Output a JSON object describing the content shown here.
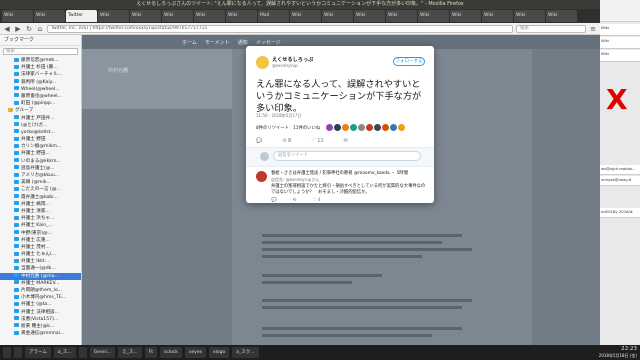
{
  "window": {
    "title": "えくせるしろっぷさんのツイート: \"えん罪になる人って、誤解されやすいというかコミュニケーションが下手な方が多い印象。\" - Mozilla Firefox"
  },
  "browser": {
    "tabs": [
      "Wiki",
      "Wiki",
      "Twitter",
      "Wiki",
      "Wiki",
      "Wiki",
      "Wiki",
      "Wiki",
      "Mail",
      "Wiki",
      "Wiki",
      "Wiki",
      "Wiki",
      "Wiki",
      "Wiki",
      "Wiki",
      "Wiki",
      "Wiki"
    ],
    "active_tab_index": 2,
    "url": "Twitter, Inc. (US) | https://twitter.com/xxxsyrup/status/997017717711",
    "search_placeholder": "検索"
  },
  "sidebar": {
    "header": "ブックマーク",
    "search_placeholder": "検索",
    "items": [
      {
        "label": "藤原信宏@meb...",
        "folder": false
      },
      {
        "label": "弁護士 杉田 (藤...",
        "folder": false
      },
      {
        "label": "法律家バーチャル...",
        "folder": false
      },
      {
        "label": "裁判所 (@Kaiy...",
        "folder": false
      },
      {
        "label": "Wheel(@wheel...",
        "folder": false
      },
      {
        "label": "藤原俊也@wheel...",
        "folder": false
      },
      {
        "label": "町田 (@pinpp...",
        "folder": false
      },
      {
        "label": "グループ",
        "folder": true
      },
      {
        "label": "弁護士 戸田弁...",
        "folder": false
      },
      {
        "label": "(@とけ)ガ...",
        "folder": false
      },
      {
        "label": "yorko@kellst...",
        "folder": false
      },
      {
        "label": "弁護士 野田",
        "folder": false
      },
      {
        "label": "カリン娘@mikm...",
        "folder": false
      },
      {
        "label": "弁護士 野田...",
        "folder": false
      },
      {
        "label": "いのまる@kkkm...",
        "folder": false
      },
      {
        "label": "逃島弁護士(@...",
        "folder": false
      },
      {
        "label": "アメリカ@kkuu...",
        "folder": false
      },
      {
        "label": "美織 (@mik...",
        "folder": false
      },
      {
        "label": "こたえの一言 (@...",
        "folder": false
      },
      {
        "label": "霞弁護士@kobi...",
        "folder": false
      },
      {
        "label": "弁護士 嶋岡...",
        "folder": false
      },
      {
        "label": "弁護士 清家...",
        "folder": false
      },
      {
        "label": "弁護士 浜ちゃ...",
        "folder": false
      },
      {
        "label": "弁護士 Kain_...",
        "folder": false
      },
      {
        "label": "中野(東京)@...",
        "folder": false
      },
      {
        "label": "弁護士 広重...",
        "folder": false
      },
      {
        "label": "弁護士 茂村...",
        "folder": false
      },
      {
        "label": "弁護士 たぁん(...",
        "folder": false
      },
      {
        "label": "弁護士 Ikkt...",
        "folder": false
      },
      {
        "label": "当面通一(@dk...",
        "folder": false
      },
      {
        "label": "中村元勝 (@ma...",
        "folder": false
      },
      {
        "label": "弁護士 MARKEV...",
        "folder": false
      },
      {
        "label": "片岡朗@them_lo...",
        "folder": false
      },
      {
        "label": "小木博内@hms_TE...",
        "folder": false
      },
      {
        "label": "弁護士 (@ta...",
        "folder": false
      },
      {
        "label": "弁護士 法律相談...",
        "folder": false
      },
      {
        "label": "法曹(Vista157)...",
        "folder": false
      },
      {
        "label": "坂東 種主(@k...",
        "folder": false
      },
      {
        "label": "黄金通信@mmnai...",
        "folder": false
      }
    ],
    "selected_index": 30
  },
  "twitter_nav": {
    "items": [
      "ホーム",
      "モーメント",
      "通知",
      "メッセージ"
    ],
    "profile_name": "中村元勝"
  },
  "tweet": {
    "display_name": "えくせるしろっぷ",
    "handle": "@excelsyrup",
    "follow_label": "フォローする",
    "text": "えん罪になる人って、誤解されやすいというかコミュニケーションが下手な方が多い印象。",
    "time": "11:50 - 2018年5月17日",
    "stats": "8件のリツイート　11件のいいね",
    "actions": [
      "💬",
      "⟲ 8",
      "♡ 11",
      "✉"
    ],
    "reply_placeholder": "返信をツイート"
  },
  "reply": {
    "name": "春絵",
    "header": "春絵・ささは弁護士発送 / 犯罪神社の教祖 @maomo_kaeda ・ 5時間",
    "to": "返信先: @excelsyrupさん",
    "body": "弁護士の冤罪相談でかたと締引・損益すべきとしている所が実質的な大事件なのではないでしょうか？　おそまし・冷酷的配信か。",
    "actions": [
      "💬",
      "⟲",
      "♡ 4"
    ]
  },
  "right_panel": {
    "blocks": [
      "Wiki",
      "Wiki",
      "Wiki",
      "ws@xjph.mobiw...",
      "xmiyak@ukay.#",
      "ed2018y 2016/#"
    ]
  },
  "taskbar": {
    "items": [
      "",
      "",
      "アラーム",
      "a_ス...",
      "",
      "Geeni...",
      "え_ス...",
      "Ft",
      "sclock",
      "xeyes",
      "xlogo",
      "a_スク..."
    ],
    "time": "22:23",
    "date": "2018年5月18日 (金)"
  }
}
